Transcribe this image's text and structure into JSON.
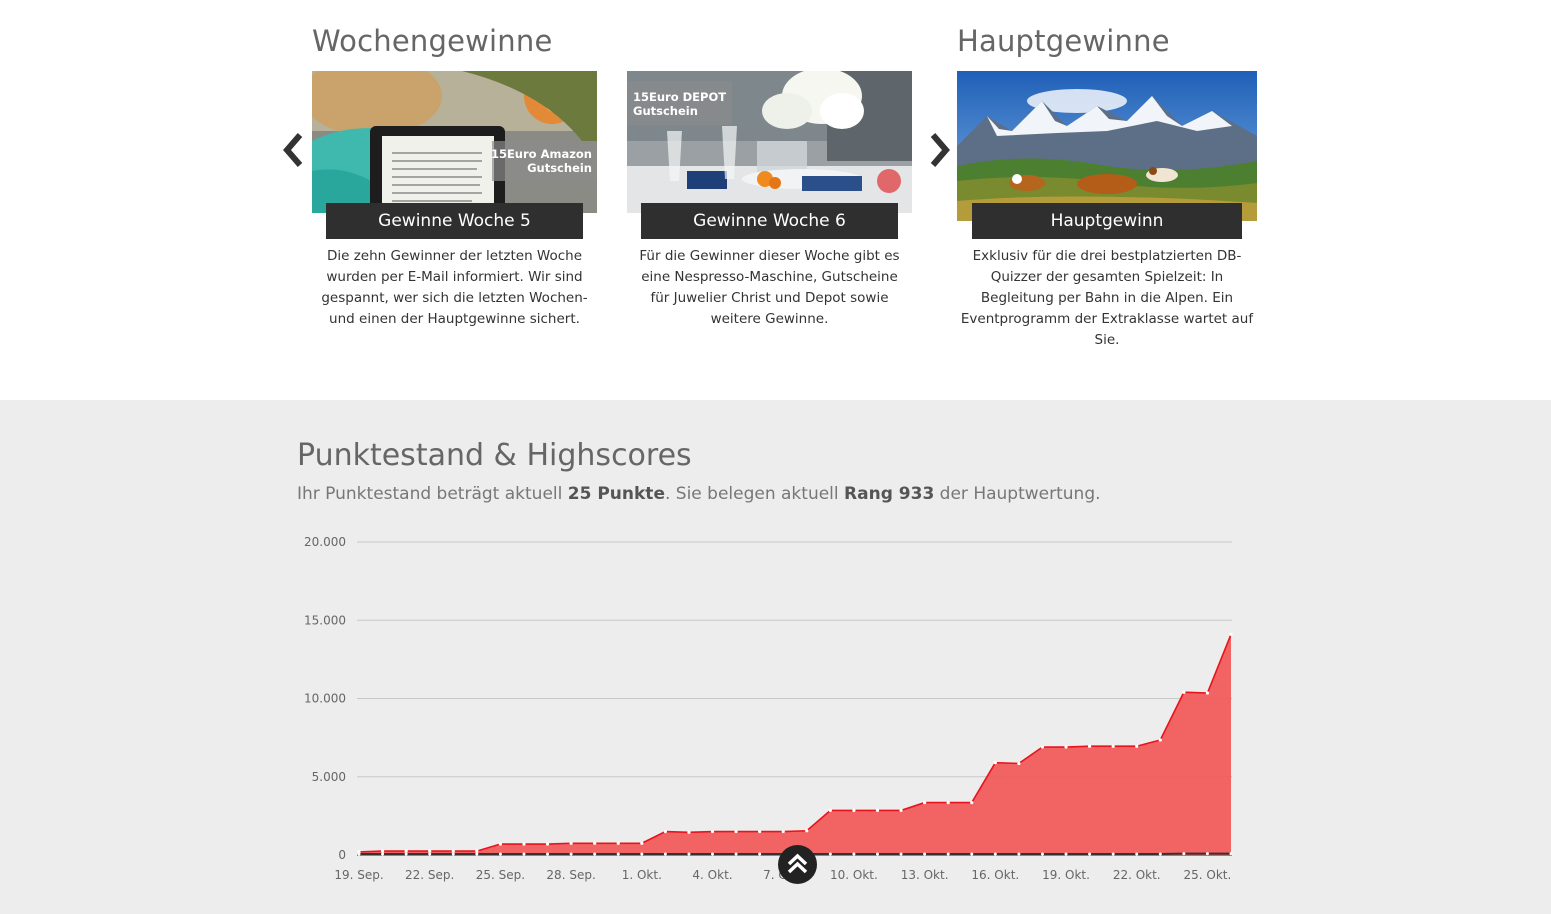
{
  "weekly": {
    "title": "Wochengewinne"
  },
  "main_prizes": {
    "title": "Hauptgewinne"
  },
  "cards": [
    {
      "overlay": [
        "15Euro Amazon",
        "Gutschein"
      ],
      "caption": "Gewinne Woche 5",
      "desc": [
        "Die zehn Gewinner der letzten Woche",
        "wurden per E-Mail informiert. Wir sind",
        "gespannt, wer sich die letzten Wochen-",
        "und einen der Hauptgewinne sichert."
      ]
    },
    {
      "overlay": [
        "15Euro DEPOT",
        "Gutschein"
      ],
      "caption": "Gewinne Woche 6",
      "desc": [
        "Für die Gewinner dieser Woche gibt es",
        "eine Nespresso-Maschine, Gutscheine",
        "für Juwelier Christ und Depot sowie",
        "weitere Gewinne."
      ]
    },
    {
      "caption": "Hauptgewinn",
      "desc": [
        "Exklusiv für die drei bestplatzierten DB-",
        "Quizzer der gesamten Spielzeit: In",
        "Begleitung per Bahn in die Alpen. Ein",
        "Eventprogramm der Extraklasse wartet auf",
        "Sie."
      ]
    }
  ],
  "icons": {
    "prev": "chevron-left-icon",
    "next": "chevron-right-icon",
    "scroll_top": "double-chevron-up-icon"
  },
  "scores": {
    "title": "Punktestand & Highscores",
    "text_pre": "Ihr Punktestand beträgt aktuell ",
    "points": "25 Punkte",
    "text_mid": ". Sie belegen aktuell ",
    "rank": "Rang 933",
    "text_post": " der Hauptwertung."
  },
  "colors": {
    "area": "#f25c5c",
    "line": "#e8141c",
    "user_line": "#333333",
    "bg_gray": "#ededed",
    "caption_bg": "#2f2f2f"
  },
  "chart_data": {
    "type": "area",
    "ylim": [
      0,
      20000
    ],
    "yticks": [
      "20.000",
      "15.000",
      "10.000",
      "5.000",
      "0"
    ],
    "ytick_values": [
      20000,
      15000,
      10000,
      5000,
      0
    ],
    "xticks": [
      "19. Sep.",
      "22. Sep.",
      "25. Sep.",
      "28. Sep.",
      "1. Okt.",
      "4. Okt.",
      "7. Okt.",
      "10. Okt.",
      "13. Okt.",
      "16. Okt.",
      "19. Okt.",
      "22. Okt.",
      "25. Okt."
    ],
    "x": [
      "19. Sep.",
      "20. Sep.",
      "21. Sep.",
      "22. Sep.",
      "23. Sep.",
      "24. Sep.",
      "25. Sep.",
      "26. Sep.",
      "27. Sep.",
      "28. Sep.",
      "29. Sep.",
      "30. Sep.",
      "1. Okt.",
      "2. Okt.",
      "3. Okt.",
      "4. Okt.",
      "5. Okt.",
      "6. Okt.",
      "7. Okt.",
      "8. Okt.",
      "9. Okt.",
      "10. Okt.",
      "11. Okt.",
      "12. Okt.",
      "13. Okt.",
      "14. Okt.",
      "15. Okt.",
      "16. Okt.",
      "17. Okt.",
      "18. Okt.",
      "19. Okt.",
      "20. Okt.",
      "21. Okt.",
      "22. Okt.",
      "23. Okt.",
      "24. Okt.",
      "25. Okt."
    ],
    "series": [
      {
        "values": [
          200,
          250,
          250,
          250,
          250,
          250,
          700,
          700,
          700,
          750,
          750,
          750,
          750,
          1500,
          1450,
          1500,
          1500,
          1500,
          1500,
          1550,
          2850,
          2850,
          2850,
          2850,
          3350,
          3350,
          3350,
          5900,
          5850,
          6900,
          6900,
          6950,
          6950,
          6950,
          7350,
          10400,
          10350,
          14100
        ]
      },
      {
        "values": [
          0,
          0,
          0,
          0,
          0,
          0,
          0,
          0,
          0,
          0,
          0,
          0,
          0,
          0,
          0,
          0,
          0,
          0,
          0,
          0,
          0,
          0,
          0,
          0,
          0,
          0,
          0,
          0,
          0,
          0,
          0,
          0,
          0,
          0,
          0,
          25,
          25,
          25
        ]
      }
    ]
  }
}
